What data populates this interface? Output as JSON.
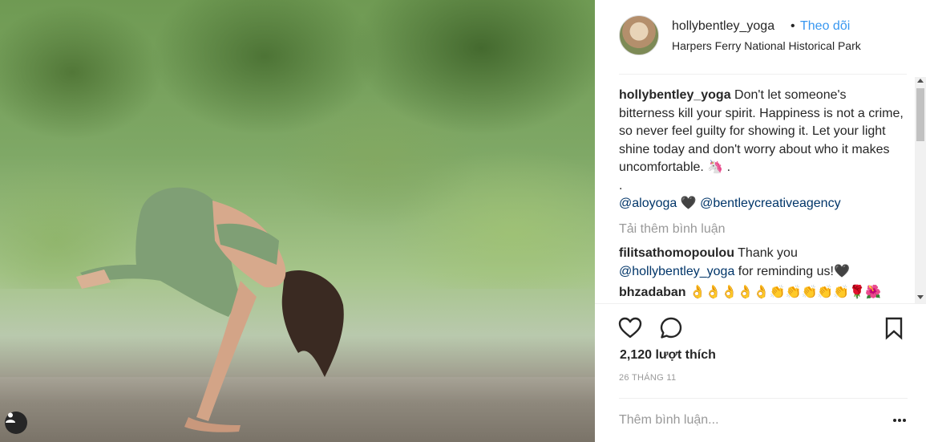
{
  "post": {
    "username": "hollybentley_yoga",
    "separator": "•",
    "follow_label": "Theo dõi",
    "location": "Harpers Ferry National Historical Park"
  },
  "caption": {
    "username": "hollybentley_yoga",
    "text": " Don't let someone's bitterness kill your spirit. Happiness is not a crime, so never feel guilty for showing it. Let your light shine today and don't worry about who it makes uncomfortable. 🦄 .",
    "dot_line": ".",
    "mention1": "@aloyoga",
    "heart": " 🖤 ",
    "mention2": "@bentleycreativeagency"
  },
  "load_more": "Tải thêm bình luận",
  "comments": [
    {
      "username": "filitsathomopoulou",
      "text_before": " Thank you ",
      "mention": "@hollybentley_yoga",
      "text_after": " for reminding us!🖤"
    },
    {
      "username": "bhzadaban",
      "text": " 👌👌👌👌👌👏👏👏👏👏🌹🌺"
    }
  ],
  "likes": "2,120 lượt thích",
  "date": "26 THÁNG 11",
  "add_comment_placeholder": "Thêm bình luận...",
  "icons": {
    "like": "heart-icon",
    "comment": "comment-icon",
    "save": "bookmark-icon",
    "options": "more-options-icon",
    "tag": "user-tag-icon"
  }
}
